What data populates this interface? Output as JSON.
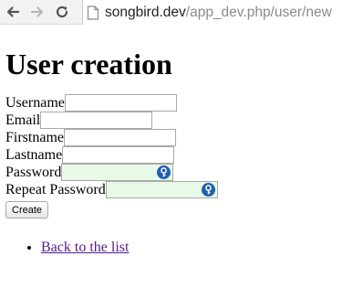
{
  "browser": {
    "url_host": "songbird.dev",
    "url_path": "/app_dev.php/user/new",
    "icons": [
      "back-arrow-icon",
      "forward-arrow-icon",
      "reload-icon",
      "page-icon"
    ]
  },
  "page": {
    "title": "User creation",
    "form": {
      "username_label": "Username",
      "email_label": "Email",
      "firstname_label": "Firstname",
      "lastname_label": "Lastname",
      "password_label": "Password",
      "repeat_password_label": "Repeat Password",
      "username_value": "",
      "email_value": "",
      "firstname_value": "",
      "lastname_value": "",
      "password_value": "",
      "repeat_password_value": "",
      "submit_label": "Create"
    },
    "links": {
      "back_label": "Back to the list"
    }
  },
  "colors": {
    "link": "#551a8b",
    "password_field_bg": "#e8f9e8",
    "key_badge": "#1f5fb0"
  }
}
